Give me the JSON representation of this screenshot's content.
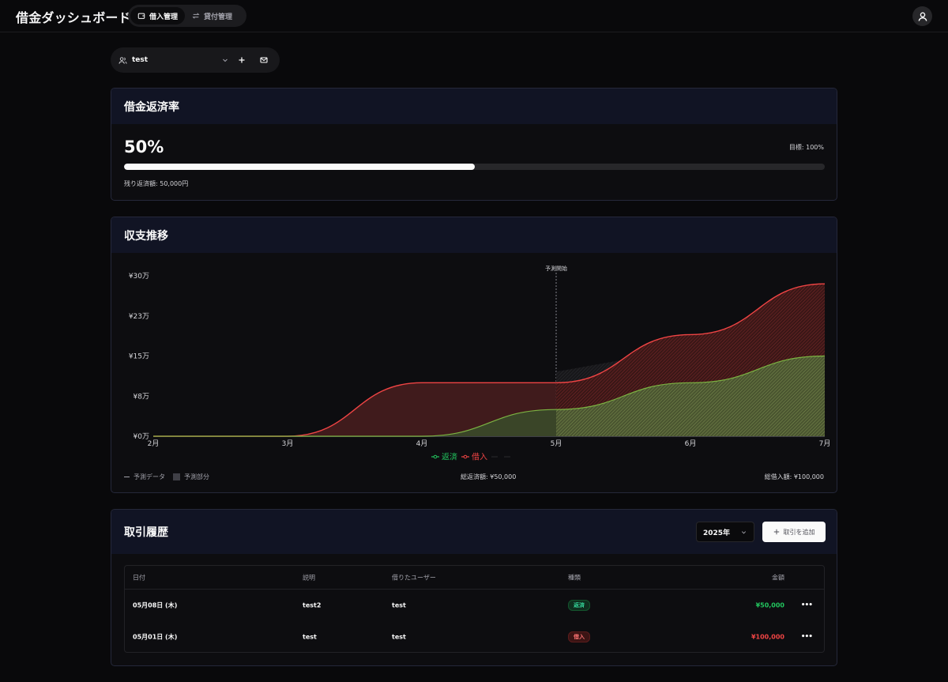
{
  "app": {
    "title": "借金ダッシュボード",
    "nav": [
      {
        "label": "借入管理",
        "active": true
      },
      {
        "label": "貸付管理",
        "active": false
      }
    ]
  },
  "user_selector": {
    "value": "test"
  },
  "progress": {
    "title": "借金返済率",
    "value_label": "50%",
    "fraction": 0.5,
    "goal": "目標: 100%",
    "remaining": "残り返済額: 50,000円"
  },
  "chart_card": {
    "title": "収支推移",
    "legend_forecast_line": "予測データ",
    "legend_forecast_area": "予測部分",
    "total_repaid": "総返済額: ¥50,000",
    "total_borrowed": "総借入額: ¥100,000"
  },
  "chart_data": {
    "type": "area",
    "x": [
      "2月",
      "3月",
      "4月",
      "5月",
      "6月",
      "7月"
    ],
    "y_ticks": [
      "¥0万",
      "¥8万",
      "¥15万",
      "¥23万",
      "¥30万"
    ],
    "ylim": [
      0,
      300000
    ],
    "forecast_start": "5月",
    "forecast_label": "予測開始",
    "series": [
      {
        "name": "返済",
        "color": "#22c55e",
        "values": [
          0,
          0,
          0,
          50000,
          100000,
          150000
        ]
      },
      {
        "name": "借入",
        "color": "#ef4444",
        "values": [
          0,
          0,
          100000,
          100000,
          190000,
          285000
        ]
      }
    ]
  },
  "transactions": {
    "title": "取引履歴",
    "year": "2025年",
    "add_label": "取引を追加",
    "columns": [
      "日付",
      "説明",
      "借りたユーザー",
      "種類",
      "金額"
    ],
    "rows": [
      {
        "date": "05月08日 (木)",
        "desc": "test2",
        "user": "test",
        "type": "返済",
        "amount": "¥50,000"
      },
      {
        "date": "05月01日 (木)",
        "desc": "test",
        "user": "test",
        "type": "借入",
        "amount": "¥100,000"
      }
    ]
  }
}
